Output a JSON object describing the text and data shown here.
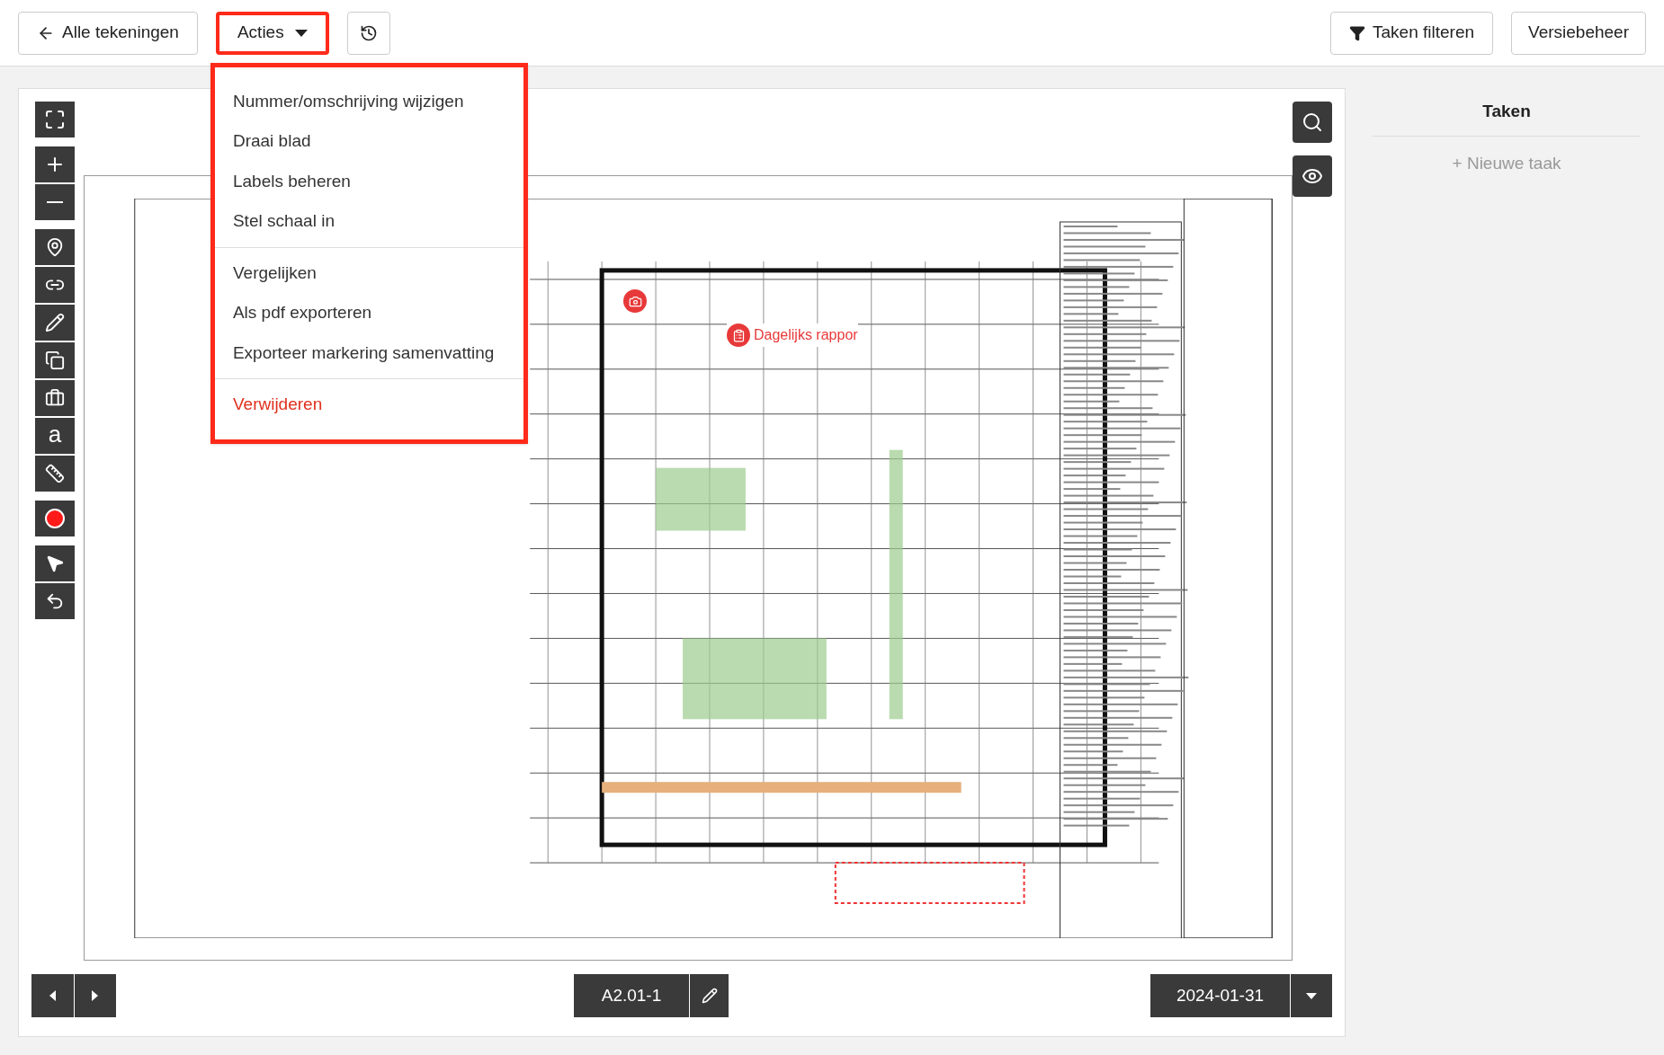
{
  "toolbar": {
    "back_button": "Alle tekeningen",
    "actions_button": {
      "label": "Acties",
      "highlighted": true
    },
    "filter_button": "Taken filteren",
    "versions_button": "Versiebeheer"
  },
  "actions_menu": {
    "expanded": true,
    "highlighted": true,
    "groups": [
      {
        "items": [
          {
            "label": "Nummer/omschrijving wijzigen",
            "kind": "normal"
          },
          {
            "label": "Draai blad",
            "kind": "normal"
          },
          {
            "label": "Labels beheren",
            "kind": "normal"
          },
          {
            "label": "Stel schaal in",
            "kind": "normal"
          }
        ]
      },
      {
        "items": [
          {
            "label": "Vergelijken",
            "kind": "normal"
          },
          {
            "label": "Als pdf exporteren",
            "kind": "normal"
          },
          {
            "label": "Exporteer markering samenvatting",
            "kind": "normal"
          }
        ]
      },
      {
        "items": [
          {
            "label": "Verwijderen",
            "kind": "danger"
          }
        ]
      }
    ]
  },
  "text_tool_glyph": "a",
  "markups": [
    {
      "kind": "photo"
    },
    {
      "kind": "report",
      "label": "Dagelijks rappor"
    }
  ],
  "tasks_panel": {
    "title": "Taken",
    "new_task": "+ Nieuwe taak"
  },
  "footer": {
    "sheet": "A2.01-1",
    "date": "2024-01-31"
  }
}
